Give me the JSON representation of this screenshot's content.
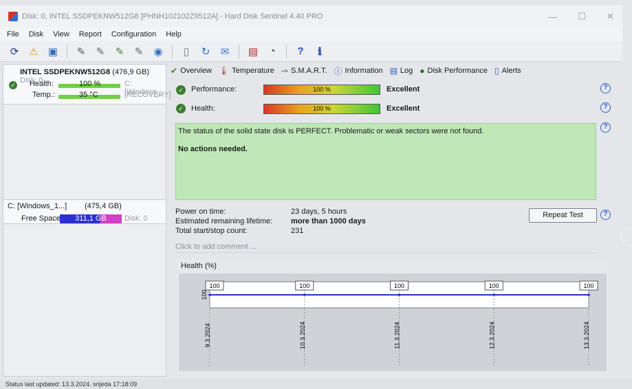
{
  "window": {
    "title": "Disk: 0, INTEL SSDPEKNW512G8 [PHNH102102Z9512A]  -  Hard Disk Sentinel 4.40 PRO",
    "controls": [
      "—",
      "☐",
      "✕"
    ]
  },
  "menu": [
    "File",
    "Disk",
    "View",
    "Report",
    "Configuration",
    "Help"
  ],
  "toolbar_icons": [
    "refresh-icon",
    "alert-icon",
    "disk-report-icon",
    "surface-test-icon",
    "short-test-icon",
    "extended-test-icon",
    "smart-icon",
    "network-icon",
    "doc-icon",
    "refresh2-icon",
    "mail-icon",
    "computer-icon",
    "sound-icon",
    "help-icon",
    "info-icon"
  ],
  "disk": {
    "name": "INTEL SSDPEKNW512G8",
    "size": "(476,9 GB)",
    "disk_tag": "Disk: 0",
    "health_label": "Health:",
    "health_value": "100 %",
    "health_drive": "C: [Windows_",
    "temp_label": "Temp.:",
    "temp_value": "35 °C",
    "temp_drive": "[RECOVERY]"
  },
  "volume": {
    "name": "C: [Windows_1...]",
    "size": "(475,4 GB)",
    "free_label": "Free Space",
    "free_value": "311,1 GB",
    "disk_tag": "Disk: 0"
  },
  "tabs": [
    "Overview",
    "Temperature",
    "S.M.A.R.T.",
    "Information",
    "Log",
    "Disk Performance",
    "Alerts"
  ],
  "overview": {
    "performance_label": "Performance:",
    "performance_value": "100 %",
    "performance_rating": "Excellent",
    "health_label": "Health:",
    "health_value": "100 %",
    "health_rating": "Excellent",
    "status_text": "The status of the solid state disk is PERFECT. Problematic or weak sectors were not found.",
    "action_text": "No actions needed.",
    "power_on_label": "Power on time:",
    "power_on_value": "23 days, 5 hours",
    "lifetime_label": "Estimated remaining lifetime:",
    "lifetime_value": "more than 1000 days",
    "startstop_label": "Total start/stop count:",
    "startstop_value": "231",
    "repeat_button": "Repeat Test",
    "comment_placeholder": "Click to add comment ..."
  },
  "chart_data": {
    "type": "line",
    "title": "Health (%)",
    "x": [
      "9.3.2024",
      "10.3.2024",
      "11.3.2024",
      "12.3.2024",
      "13.3.2024"
    ],
    "values": [
      100,
      100,
      100,
      100,
      100
    ],
    "ylim": [
      100,
      100
    ],
    "y_tick": "100",
    "grid": true,
    "color": "#2233cc"
  },
  "status_bar": "Status last updated: 13.3.2024. srijeda 17:18:09",
  "colors": {
    "status_ok": "#bfe7b8",
    "accent_blue": "#2d5ec2",
    "bar_green": "#43c43a"
  }
}
